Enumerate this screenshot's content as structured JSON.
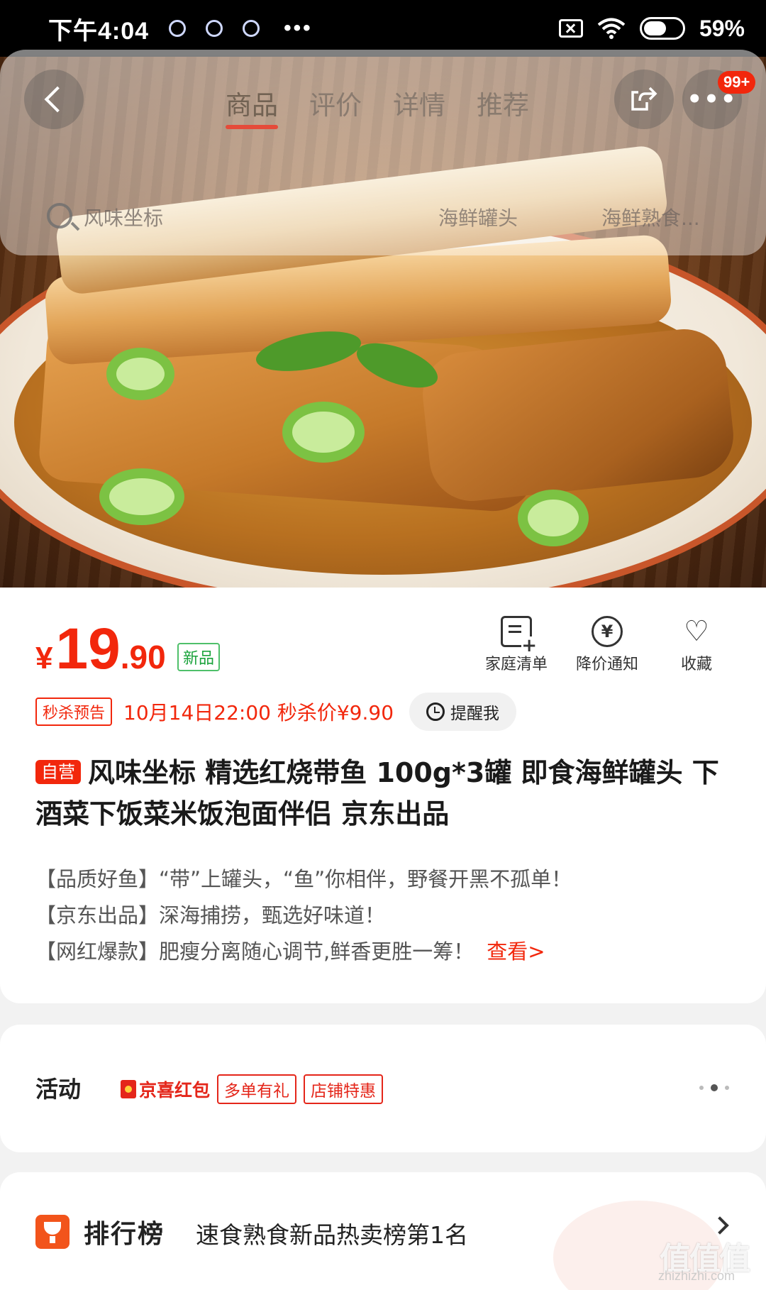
{
  "status_bar": {
    "time": "下午4:04",
    "dots": "•••",
    "battery": "59%",
    "battery_level": 0.59,
    "icons": [
      "sim-off-icon",
      "wifi-icon",
      "battery-icon"
    ]
  },
  "nav": {
    "tabs": [
      "商品",
      "评价",
      "详情",
      "推荐"
    ],
    "active_tab": 0,
    "badge": "99+",
    "search_placeholder": "风味坐标",
    "hot_words": [
      "海鲜罐头",
      "海鲜熟食..."
    ]
  },
  "product": {
    "price_currency": "¥",
    "price_integer": "19",
    "price_decimal": ".90",
    "new_tag": "新品",
    "actions": [
      "家庭清单",
      "降价通知",
      "收藏"
    ],
    "seckill_tag": "秒杀预告",
    "seckill_text": "10月14日22:00 秒杀价¥9.90",
    "remind": "提醒我",
    "self_tag": "自营",
    "title": "风味坐标 精选红烧带鱼 100g*3罐 即食海鲜罐头 下酒菜下饭菜米饭泡面伴侣 京东出品",
    "selling_points": [
      "【品质好鱼】“带”上罐头，“鱼”你相伴，野餐开黑不孤单！",
      "【京东出品】深海捕捞，甄选好味道！",
      "【网红爆款】肥瘦分离随心调节,鲜香更胜一筹！"
    ],
    "view_more": "查看>"
  },
  "activity": {
    "title": "活动",
    "tags": [
      "京喜红包",
      "多单有礼",
      "店铺特惠"
    ]
  },
  "ranking": {
    "name": "排行榜",
    "text": "速食熟食新品热卖榜第1名"
  },
  "watermark": {
    "text": "值值值",
    "sub": "zhizhizhi.com"
  },
  "colors": {
    "accent": "#f2270c",
    "new_tag": "#1ba33c"
  }
}
